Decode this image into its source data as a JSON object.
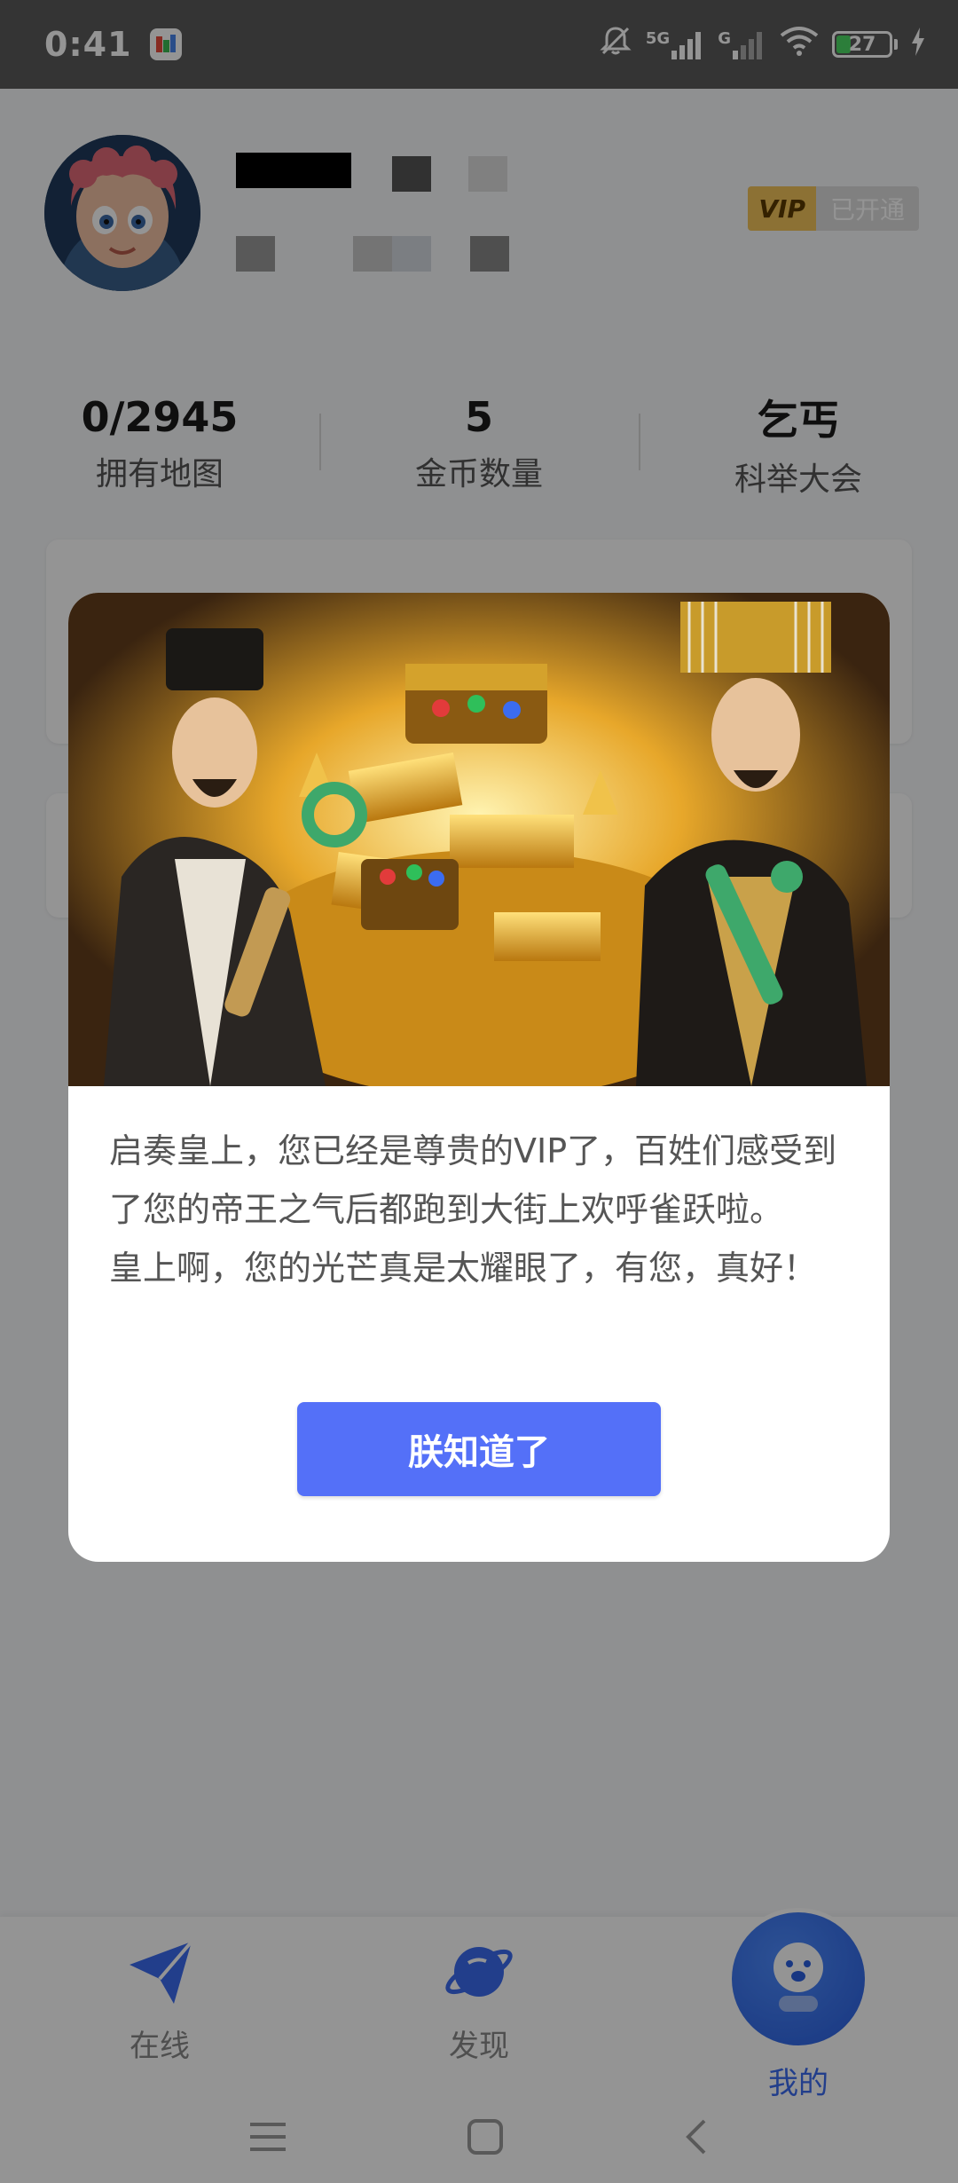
{
  "status_bar": {
    "time": "0:41",
    "network_primary": "5G",
    "network_secondary": "G",
    "battery": "27",
    "battery_level": 0.27
  },
  "profile": {
    "vip_label": "VIP",
    "vip_status": "已开通"
  },
  "stats": [
    {
      "value": "0/2945",
      "label": "拥有地图"
    },
    {
      "value": "5",
      "label": "金币数量"
    },
    {
      "value": "乞丐",
      "label": "科举大会"
    }
  ],
  "dialog": {
    "text_1": "启奏皇上，您已经是尊贵的VIP了，百姓们感受到了您的帝王之气后都跑到大街上欢呼雀跃啦。",
    "text_2": "皇上啊，您的光芒真是太耀眼了，有您，真好！",
    "button": "朕知道了"
  },
  "nav": {
    "items": [
      {
        "label": "在线",
        "icon": "paper-plane-icon"
      },
      {
        "label": "发现",
        "icon": "planet-icon"
      },
      {
        "label": "我的",
        "icon": "smiley-icon"
      }
    ],
    "active_color": "#3c6cf0"
  },
  "colors": {
    "primary_button": "#5470f8",
    "vip_gold": "#f1c35a"
  }
}
